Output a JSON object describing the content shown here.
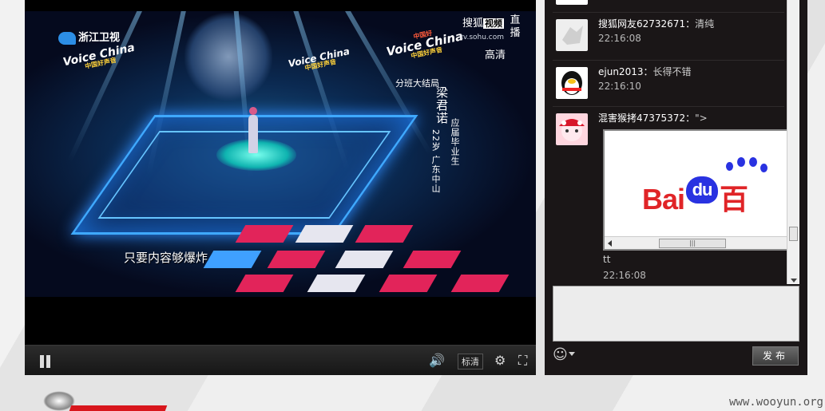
{
  "video": {
    "channel_logo": "浙江卫视",
    "show_logo": "Voice China",
    "show_logo_sub": "中国好声音",
    "show_logo_tag": "中国好",
    "sohu_brand": "搜狐",
    "sohu_brand_box": "视频",
    "sohu_url": "tv.sohu.com",
    "live_label": "直播",
    "hd_label": "高清",
    "round_label": "分班大结局",
    "contestant_name": "梁君诺",
    "contestant_info_1": "应届毕业生",
    "contestant_info_2": "22岁 广东中山",
    "subtitle": "只要内容够爆炸"
  },
  "controls": {
    "quality_label": "标清",
    "icons": [
      "pause-icon",
      "volume-icon",
      "gear-icon",
      "fullscreen-icon"
    ]
  },
  "chat": {
    "messages": [
      {
        "user": "搜狐网友62732671",
        "text": "清纯",
        "time": "22:16:08"
      },
      {
        "user": "ejun2013",
        "text": "长得不错",
        "time": "22:16:10"
      },
      {
        "user": "混害猴拷47375372",
        "text": "\">",
        "after_text": "tt",
        "time": "22:16:08"
      }
    ],
    "embed_brand": "Bai",
    "embed_brand_du": "du",
    "embed_brand_tail": "百",
    "send_label": "发布",
    "emoji_icon": "smiley-icon"
  },
  "footer": {
    "watermark": "www.wooyun.org"
  },
  "colors": {
    "accent_red": "#d8161c",
    "baidu_blue": "#2932e1",
    "baidu_red": "#e02427"
  }
}
